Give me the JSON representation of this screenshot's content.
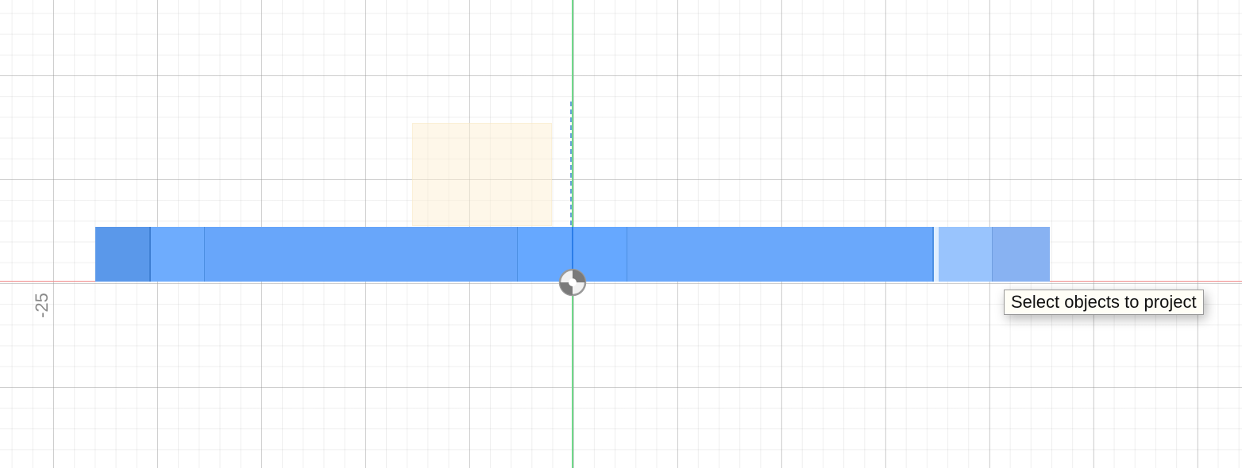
{
  "viewport": {
    "axis_label": "-25",
    "tooltip_text": "Select objects to project"
  },
  "colors": {
    "x_axis": "#f08a8a",
    "y_axis": "#6fd98a",
    "selected_body": "#6aa8fb",
    "sketch_profile": "#fdf0d4"
  },
  "icons": {
    "origin": "origin-icon"
  }
}
